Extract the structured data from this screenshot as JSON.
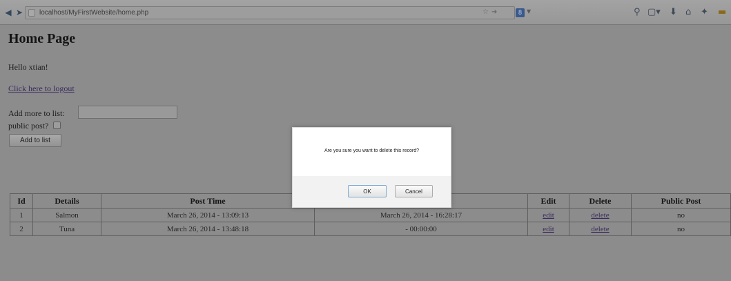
{
  "browser": {
    "url": "localhost/MyFirstWebsite/home.php",
    "search_engine_letter": "8"
  },
  "page": {
    "title": "Home Page",
    "greeting": "Hello xtian!",
    "logout_link": "Click here to logout",
    "add_label": "Add more to list:",
    "add_value": "",
    "public_label": "public post?",
    "public_checked": false,
    "add_button": "Add to list"
  },
  "table": {
    "headers": [
      "Id",
      "Details",
      "Post Time",
      "",
      "Edit",
      "Delete",
      "Public Post"
    ],
    "rows": [
      {
        "id": "1",
        "details": "Salmon",
        "post_time": "March 26, 2014 - 13:09:13",
        "edit_time": "March 26, 2014 - 16:28:17",
        "edit": "edit",
        "delete": "delete",
        "public": "no"
      },
      {
        "id": "2",
        "details": "Tuna",
        "post_time": "March 26, 2014 - 13:48:18",
        "edit_time": "- 00:00:00",
        "edit": "edit",
        "delete": "delete",
        "public": "no"
      }
    ]
  },
  "dialog": {
    "message": "Are you sure you want to delete this record?",
    "ok_label": "OK",
    "cancel_label": "Cancel"
  }
}
